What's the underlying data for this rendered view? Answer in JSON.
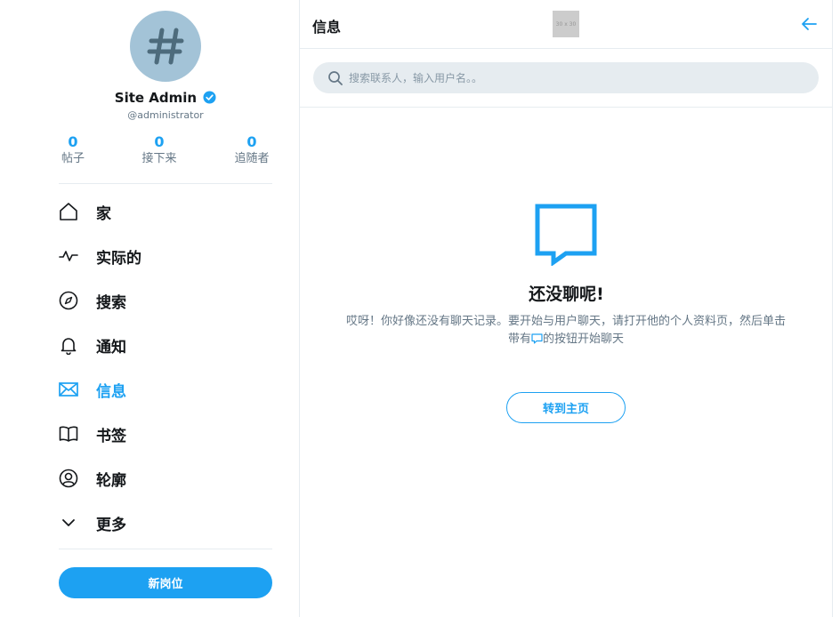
{
  "profile": {
    "avatar_symbol": "#",
    "name": "Site Admin",
    "handle": "@administrator",
    "stats": [
      {
        "value": "0",
        "label": "帖子"
      },
      {
        "value": "0",
        "label": "接下来"
      },
      {
        "value": "0",
        "label": "追随者"
      }
    ]
  },
  "nav": {
    "items": [
      {
        "label": "家",
        "icon": "home-icon"
      },
      {
        "label": "实际的",
        "icon": "activity-icon"
      },
      {
        "label": "搜索",
        "icon": "compass-icon"
      },
      {
        "label": "通知",
        "icon": "bell-icon"
      },
      {
        "label": "信息",
        "icon": "mail-icon",
        "active": true
      },
      {
        "label": "书签",
        "icon": "book-icon"
      },
      {
        "label": "轮廓",
        "icon": "user-circle-icon"
      },
      {
        "label": "更多",
        "icon": "chevron-down-icon"
      }
    ],
    "new_post_label": "新岗位"
  },
  "header": {
    "title": "信息",
    "placeholder_image_text": "30 x 30"
  },
  "search": {
    "placeholder": "搜索联系人，输入用户名。。"
  },
  "empty_state": {
    "title": "还没聊呢!",
    "description_before": "哎呀！你好像还没有聊天记录。要开始与用户聊天，请打开他的个人资料页，然后单击带有",
    "description_after": "的按钮开始聊天",
    "button_label": "转到主页"
  },
  "colors": {
    "accent": "#1da1f2",
    "avatar_bg": "#a3c3d7",
    "muted_text": "#657786",
    "border": "#e6ecf0"
  }
}
